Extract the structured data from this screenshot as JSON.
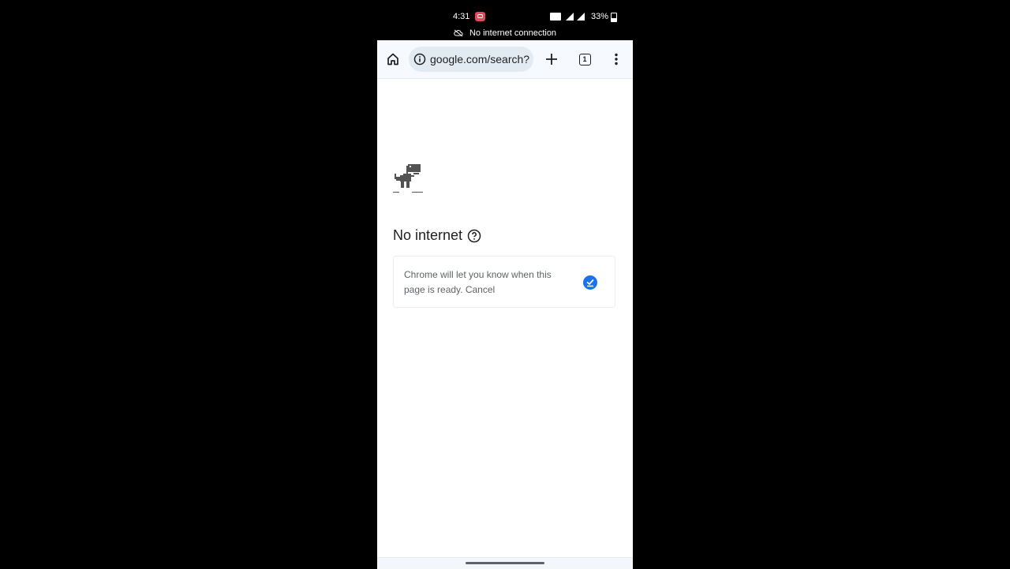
{
  "status_bar": {
    "time": "4:31",
    "battery": "33%",
    "network_notice": "No internet connection"
  },
  "toolbar": {
    "url": "google.com/search?",
    "tab_count": "1",
    "icons": [
      "home-icon",
      "info-icon",
      "plus-icon",
      "tab-switcher-icon",
      "more-vert-icon"
    ]
  },
  "page": {
    "title": "No internet",
    "card_text": "Chrome will let you know when this page is ready.",
    "cancel_label": "Cancel",
    "accent_color": "#1a73e8"
  }
}
